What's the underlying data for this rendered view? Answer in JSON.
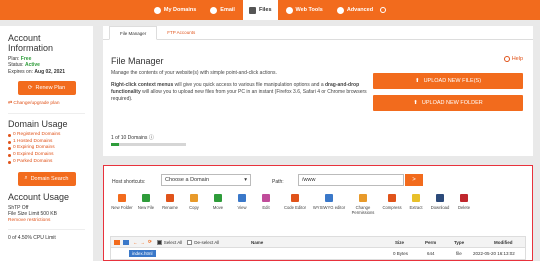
{
  "nav": [
    {
      "label": "My Domains",
      "active": false
    },
    {
      "label": "Email",
      "active": false
    },
    {
      "label": "Files",
      "active": true
    },
    {
      "label": "Web Tools",
      "active": false
    },
    {
      "label": "Advanced",
      "active": false
    }
  ],
  "sidebar": {
    "account_title": "Account Information",
    "plan_label": "Plan: ",
    "plan": "Free",
    "status_label": "Status: ",
    "status": "Active",
    "expires_label": "Expires on: ",
    "expires": "Aug 02, 2021",
    "renew_label": "Renew Plan",
    "change_label": "Change/upgrade plan",
    "usage_title": "Domain Usage",
    "domains": [
      "0 Registered Domains",
      "1 Hosted Domains",
      "0 Expiring Domains",
      "0 Expired Domains",
      "0 Parked Domains"
    ],
    "search_label": "Domain Search",
    "account_usage_title": "Account Usage",
    "shttp": "ShTP Off",
    "file_size": "File Size Limit 500 KB",
    "remove": "Remove restrictions",
    "cpu": "0 of 4.50% CPU Limit"
  },
  "main": {
    "tabs": [
      "File Manager",
      "FTP Accounts"
    ],
    "title": "File Manager",
    "help": "Help",
    "desc1": "Manage the contents of your website(s) with simple point-and-click actions.",
    "desc2_b1": "Right-click context menus",
    "desc2_t1": " will give you quick access to various file manipulation options and a ",
    "desc2_b2": "drag-and-drop functionality",
    "desc2_t2": " will allow you to upload new files from your PC in an instant (Firefox 3.6, Safari 4 or Chrome browsers required).",
    "upload_files": "UPLOAD NEW FILE(S)",
    "upload_folder": "UPLOAD NEW FOLDER",
    "domain_count": "1 of 10 Domains",
    "domain_progress": 0.1
  },
  "panel": {
    "shortcuts_label": "Host shortcuts:",
    "shortcut_value": "Choose a Domain",
    "path_label": "Path:",
    "path_value": "/www",
    "go": ">",
    "tools": [
      {
        "label": "New Folder",
        "color": "#f26b1d"
      },
      {
        "label": "New File",
        "color": "#2e9c3a"
      },
      {
        "label": "Rename",
        "color": "#e0531a"
      },
      {
        "label": "Copy",
        "color": "#e89a2a"
      },
      {
        "label": "Move",
        "color": "#2e9c3a"
      },
      {
        "label": "View",
        "color": "#3a78c9"
      },
      {
        "label": "Edit",
        "color": "#c04c9a"
      },
      {
        "label": "Code Editor",
        "color": "#e0531a"
      },
      {
        "label": "WYSIWYG editor",
        "color": "#3a78c9"
      },
      {
        "label": "Change Permissions",
        "color": "#e89a2a"
      },
      {
        "label": "Compress",
        "color": "#e0531a"
      },
      {
        "label": "Extract",
        "color": "#e8c02a"
      },
      {
        "label": "Download",
        "color": "#2c4a7a"
      },
      {
        "label": "Delete",
        "color": "#c0272d"
      }
    ],
    "select_all": "Select All",
    "deselect_all": "De-select All",
    "cols": {
      "name": "Name",
      "size": "Size",
      "perm": "Perm",
      "type": "Type",
      "modified": "Modified"
    },
    "row": {
      "name": "index.html",
      "size": "0 Bytes",
      "perm": "644",
      "type": "file",
      "modified": "2022-05-20 16:13:02"
    }
  }
}
